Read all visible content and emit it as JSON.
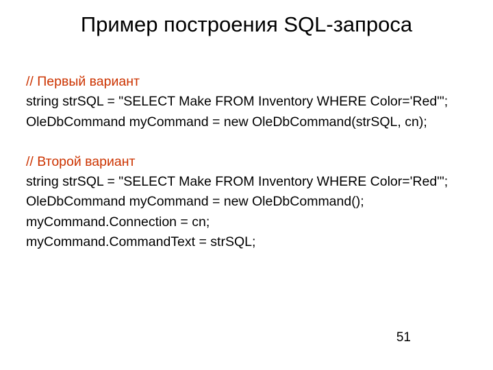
{
  "title": "Пример построения SQL-запроса",
  "variant1": {
    "comment": "// Первый вариант",
    "line1": "string strSQL = \"SELECT Make FROM Inventory WHERE Color='Red'\";",
    "line2": "OleDbCommand myCommand = new OleDbCommand(strSQL, cn);"
  },
  "variant2": {
    "comment": "// Второй вариант",
    "line1": "string strSQL = \"SELECT Make FROM Inventory WHERE Color='Red'\";",
    "line2": "OleDbCommand myCommand = new OleDbCommand();",
    "line3": "myCommand.Connection = cn;",
    "line4": "myCommand.CommandText = strSQL;"
  },
  "page_number": "51"
}
